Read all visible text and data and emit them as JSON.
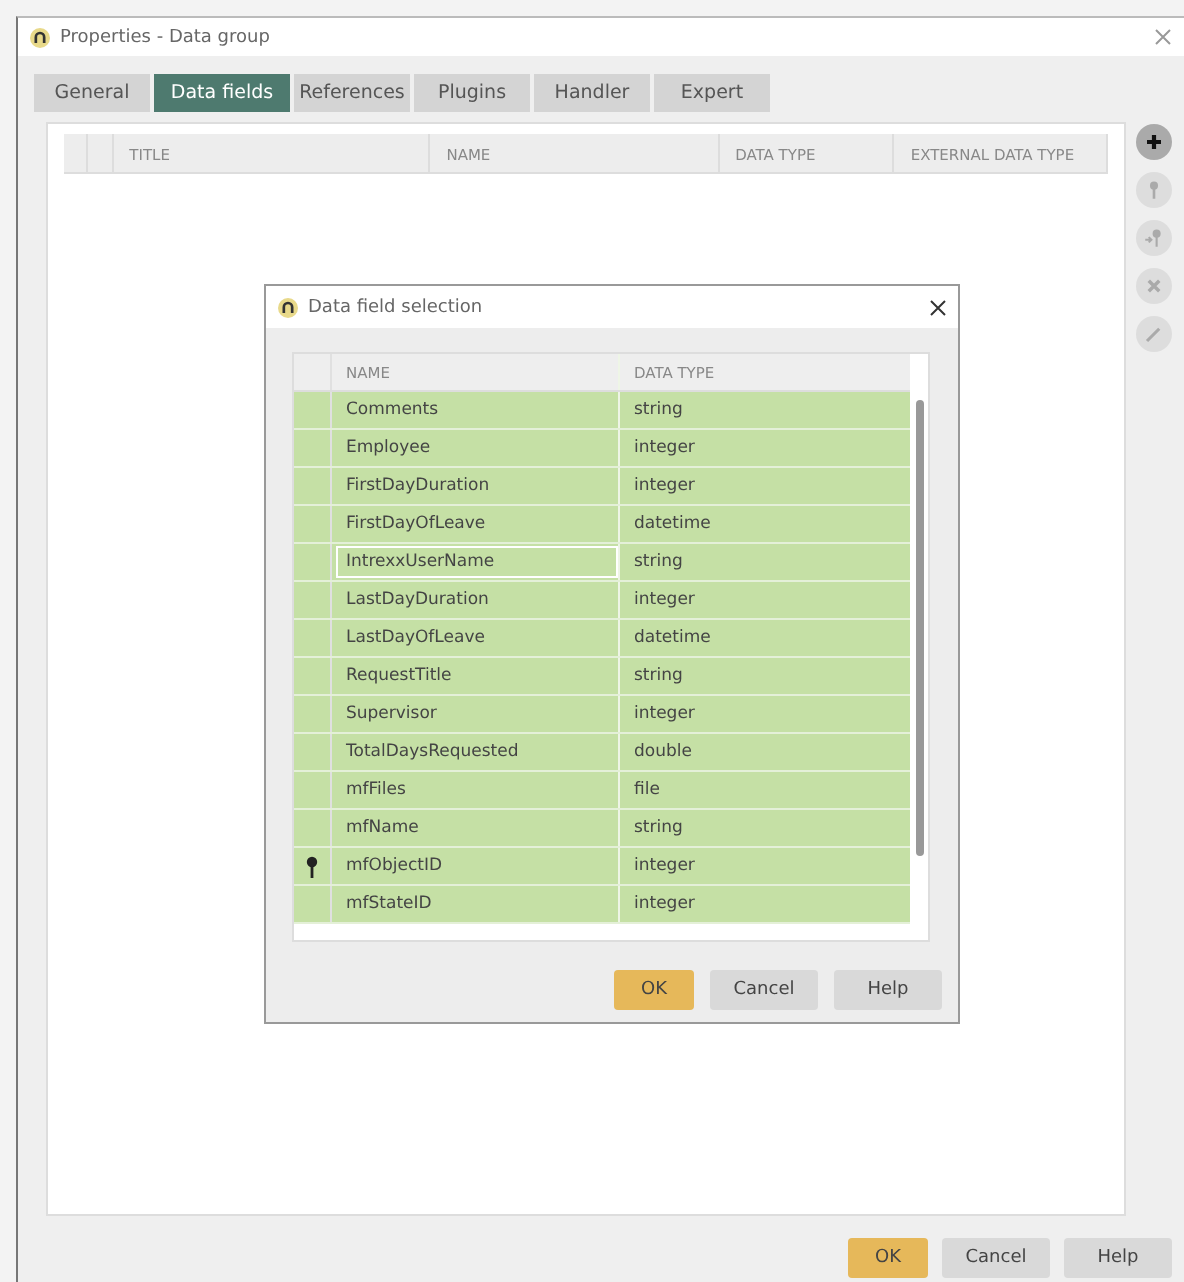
{
  "window": {
    "title": "Properties - Data group"
  },
  "tabs": [
    {
      "label": "General",
      "selected": false
    },
    {
      "label": "Data fields",
      "selected": true
    },
    {
      "label": "References",
      "selected": false
    },
    {
      "label": "Plugins",
      "selected": false
    },
    {
      "label": "Handler",
      "selected": false
    },
    {
      "label": "Expert",
      "selected": false
    }
  ],
  "table": {
    "columns": [
      "TITLE",
      "NAME",
      "DATA TYPE",
      "EXTERNAL DATA TYPE"
    ]
  },
  "side_buttons": [
    {
      "kind": "add",
      "disabled": false
    },
    {
      "kind": "key",
      "disabled": true
    },
    {
      "kind": "key-arrow",
      "disabled": true
    },
    {
      "kind": "delete",
      "disabled": true
    },
    {
      "kind": "edit",
      "disabled": true
    }
  ],
  "dialog": {
    "title": "Data field selection",
    "columns": [
      "NAME",
      "DATA TYPE"
    ],
    "rows": [
      {
        "name": "Comments",
        "type": "string",
        "selected": true,
        "focused": false,
        "key": false
      },
      {
        "name": "Employee",
        "type": "integer",
        "selected": true,
        "focused": false,
        "key": false
      },
      {
        "name": "FirstDayDuration",
        "type": "integer",
        "selected": true,
        "focused": false,
        "key": false
      },
      {
        "name": "FirstDayOfLeave",
        "type": "datetime",
        "selected": true,
        "focused": false,
        "key": false
      },
      {
        "name": "IntrexxUserName",
        "type": "string",
        "selected": true,
        "focused": true,
        "key": false
      },
      {
        "name": "LastDayDuration",
        "type": "integer",
        "selected": true,
        "focused": false,
        "key": false
      },
      {
        "name": "LastDayOfLeave",
        "type": "datetime",
        "selected": true,
        "focused": false,
        "key": false
      },
      {
        "name": "RequestTitle",
        "type": "string",
        "selected": true,
        "focused": false,
        "key": false
      },
      {
        "name": "Supervisor",
        "type": "integer",
        "selected": true,
        "focused": false,
        "key": false
      },
      {
        "name": "TotalDaysRequested",
        "type": "double",
        "selected": true,
        "focused": false,
        "key": false
      },
      {
        "name": "mfFiles",
        "type": "file",
        "selected": true,
        "focused": false,
        "key": false
      },
      {
        "name": "mfName",
        "type": "string",
        "selected": true,
        "focused": false,
        "key": false
      },
      {
        "name": "mfObjectID",
        "type": "integer",
        "selected": true,
        "focused": false,
        "key": true
      },
      {
        "name": "mfStateID",
        "type": "integer",
        "selected": true,
        "focused": false,
        "key": false
      }
    ],
    "buttons": [
      {
        "label": "OK",
        "kind": "primary"
      },
      {
        "label": "Cancel",
        "kind": "normal"
      },
      {
        "label": "Help",
        "kind": "normal"
      }
    ]
  },
  "buttons": [
    {
      "label": "OK",
      "kind": "primary"
    },
    {
      "label": "Cancel",
      "kind": "normal"
    },
    {
      "label": "Help",
      "kind": "normal"
    }
  ]
}
